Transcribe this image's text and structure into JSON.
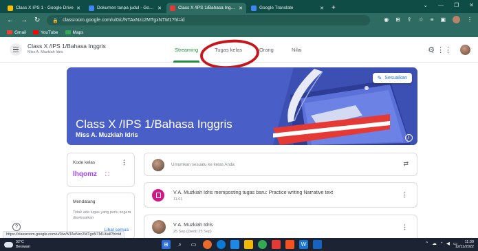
{
  "browser": {
    "tabs": [
      {
        "title": "Class X IPS 1 - Google Drive",
        "fav_color": "#fbbc04",
        "active": false
      },
      {
        "title": "Dokumen tanpa judul - Google D",
        "fav_color": "#4285f4",
        "active": false
      },
      {
        "title": "Class X /IPS 1/Bahasa Inggris Mi",
        "fav_color": "#e53935",
        "active": true
      },
      {
        "title": "Google Translate",
        "fav_color": "#4285f4",
        "active": false
      }
    ],
    "new_tab": "+",
    "url": "classroom.google.com/u/0/c/NTAxNzc2MTgxNTM1?hl=id",
    "bookmarks": [
      {
        "label": "Gmail",
        "color": "#ea4335"
      },
      {
        "label": "YouTube",
        "color": "#ff0000"
      },
      {
        "label": "Maps",
        "color": "#34a853"
      }
    ]
  },
  "header": {
    "class_title": "Class X /IPS 1/Bahasa Inggris",
    "teacher": "Miss A. Muzkiah Idris",
    "nav": [
      {
        "label": "Streaming",
        "active": true
      },
      {
        "label": "Tugas kelas",
        "active": false
      },
      {
        "label": "Orang",
        "active": false
      },
      {
        "label": "Nilai",
        "active": false
      }
    ]
  },
  "banner": {
    "title": "Class X /IPS 1/Bahasa Inggris",
    "teacher": "Miss A. Muzkiah Idris",
    "customize_label": "Sesuaikan",
    "info_glyph": "i"
  },
  "class_code": {
    "label": "Kode kelas",
    "value": "lhqomz"
  },
  "upcoming": {
    "title": "Mendatang",
    "text": "Tidak ada tugas yang perlu segera diselesaikan",
    "see_all": "Lihat semua"
  },
  "stream": {
    "announce_placeholder": "Umumkan sesuatu ke kelas Anda",
    "posts": [
      {
        "title": "V A. Muzkiah Idris memposting tugas baru: Practice writing Narrative text",
        "date": "11.01"
      },
      {
        "title": "V A. Muzkiah Idris",
        "date": "25 Sep (Diedit 25 Sep)"
      }
    ]
  },
  "status_url": "https://classroom.google.com/u/0/w/NTAxNzc2MTgxNTM1/t/all?hl=id",
  "taskbar": {
    "temperature": "32°C",
    "weather": "Berawan",
    "time": "11:30",
    "date": "12/11/2022"
  }
}
